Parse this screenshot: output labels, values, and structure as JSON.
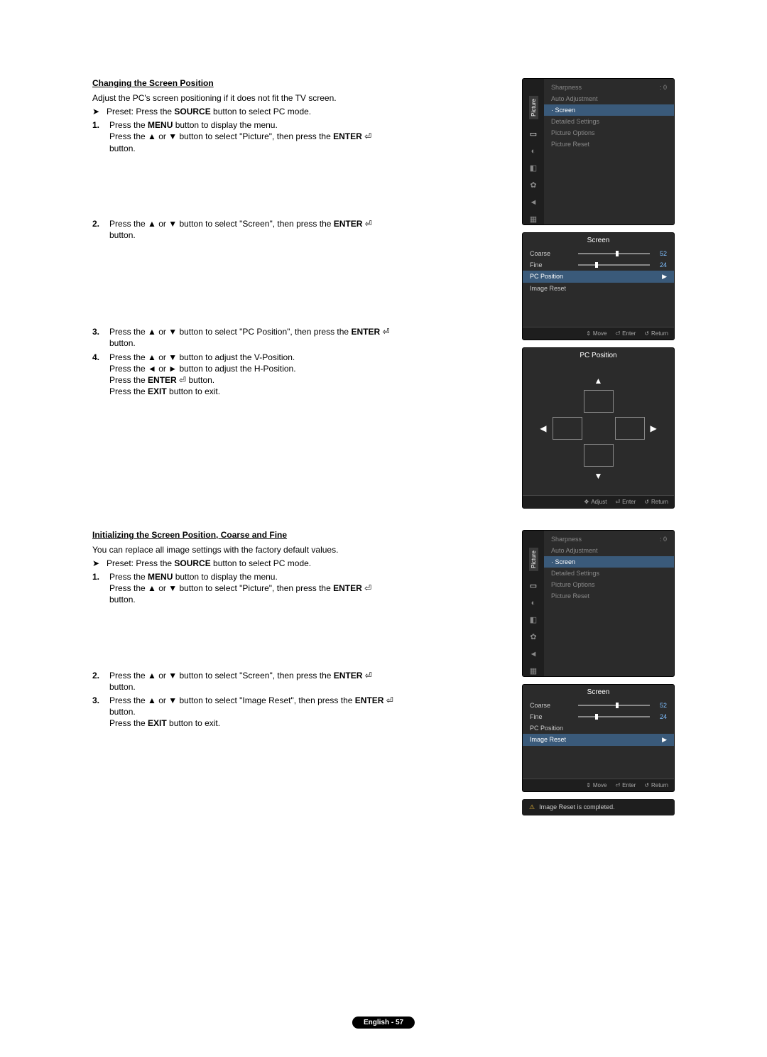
{
  "section1": {
    "title": "Changing the Screen Position",
    "intro": "Adjust the PC's screen positioning if it does not fit the TV screen.",
    "preset_prefix": "Preset: Press the ",
    "preset_bold": "SOURCE",
    "preset_suffix": " button to select PC mode.",
    "step1_a": "Press the ",
    "step1_b": "MENU",
    "step1_c": " button to display the menu.",
    "step1_d": "Press the ▲ or ▼ button to select \"Picture\", then press the ",
    "step1_e": "ENTER",
    "step1_f": " button.",
    "step2_a": "Press the ▲ or ▼ button to select \"Screen\", then press the ",
    "step2_b": "ENTER",
    "step2_c": " button.",
    "step3_a": "Press the ▲ or ▼ button to select \"PC Position\", then press the ",
    "step3_b": "ENTER",
    "step3_c": " button.",
    "step4_a": "Press the ▲ or ▼ button to adjust the V-Position.",
    "step4_b": "Press the ◄ or ► button to adjust the H-Position.",
    "step4_c1": "Press the ",
    "step4_c2": "ENTER",
    "step4_c3": " button.",
    "step4_d1": "Press the ",
    "step4_d2": "EXIT",
    "step4_d3": " button to exit."
  },
  "section2": {
    "title": "Initializing the Screen Position, Coarse and Fine",
    "intro": "You can replace all image settings with the factory default values.",
    "preset_prefix": "Preset: Press the ",
    "preset_bold": "SOURCE",
    "preset_suffix": " button to select PC mode.",
    "step1_a": "Press the ",
    "step1_b": "MENU",
    "step1_c": " button to display the menu.",
    "step1_d": "Press the ▲ or ▼ button to select \"Picture\", then press the ",
    "step1_e": "ENTER",
    "step1_f": " button.",
    "step2_a": "Press the ▲ or ▼ button to select \"Screen\", then press the ",
    "step2_b": "ENTER",
    "step2_c": " button.",
    "step3_a": "Press the ▲ or ▼ button to select \"Image Reset\", then press the ",
    "step3_b": "ENTER",
    "step3_c": " button.",
    "step3_d1": "Press the ",
    "step3_d2": "EXIT",
    "step3_d3": " button to exit."
  },
  "osd": {
    "picture_tab": "Picture",
    "sharpness": "Sharpness",
    "sharpness_val": ": 0",
    "auto_adjustment": "Auto Adjustment",
    "screen": "Screen",
    "detailed_settings": "Detailed Settings",
    "picture_options": "Picture Options",
    "picture_reset": "Picture Reset",
    "screen_title": "Screen",
    "coarse": "Coarse",
    "coarse_val": "52",
    "fine": "Fine",
    "fine_val": "24",
    "pc_position": "PC Position",
    "image_reset": "Image Reset",
    "pc_position_title": "PC Position",
    "footer_move": "Move",
    "footer_adjust": "Adjust",
    "footer_enter": "Enter",
    "footer_return": "Return",
    "toast": "Image Reset is completed."
  },
  "footer": {
    "page": "English - 57"
  },
  "nums": {
    "n1": "1.",
    "n2": "2.",
    "n3": "3.",
    "n4": "4."
  },
  "icons": {
    "preset_arrow": "➤",
    "enter": "⏎",
    "warn": "⚠"
  }
}
